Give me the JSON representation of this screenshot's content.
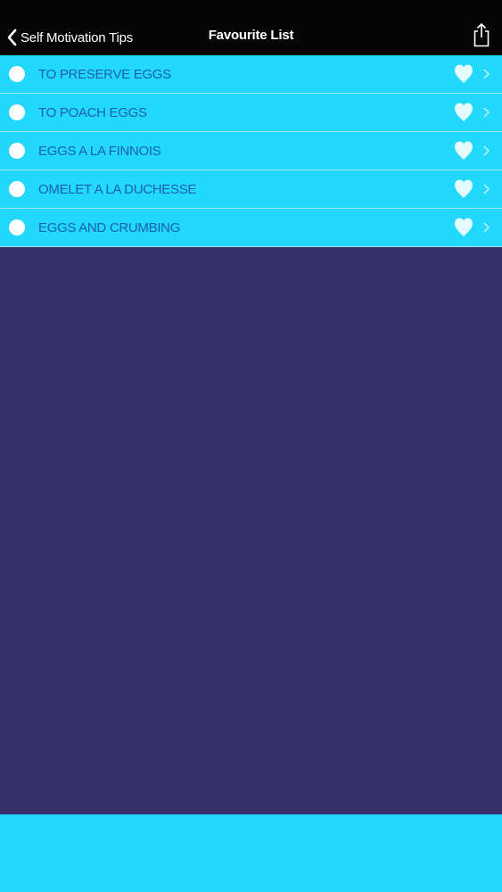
{
  "navbar": {
    "back_label": "Self Motivation Tips",
    "title": "Favourite List",
    "back_icon": "chevron-left-icon",
    "share_icon": "share-icon"
  },
  "favourites": {
    "items": [
      {
        "label": "TO PRESERVE EGGS"
      },
      {
        "label": "TO POACH EGGS"
      },
      {
        "label": "EGGS A LA FINNOIS"
      },
      {
        "label": "OMELET A LA DUCHESSE"
      },
      {
        "label": "EGGS AND CRUMBING"
      }
    ],
    "bullet_icon": "circle-icon",
    "favourite_icon": "heart-icon",
    "disclosure_icon": "chevron-right-icon"
  },
  "colors": {
    "navbar_bg": "#050505",
    "row_bg": "#22d8fc",
    "row_text": "#1b5fae",
    "content_bg": "#37306b",
    "bottom_bar_bg": "#22d8fc"
  }
}
